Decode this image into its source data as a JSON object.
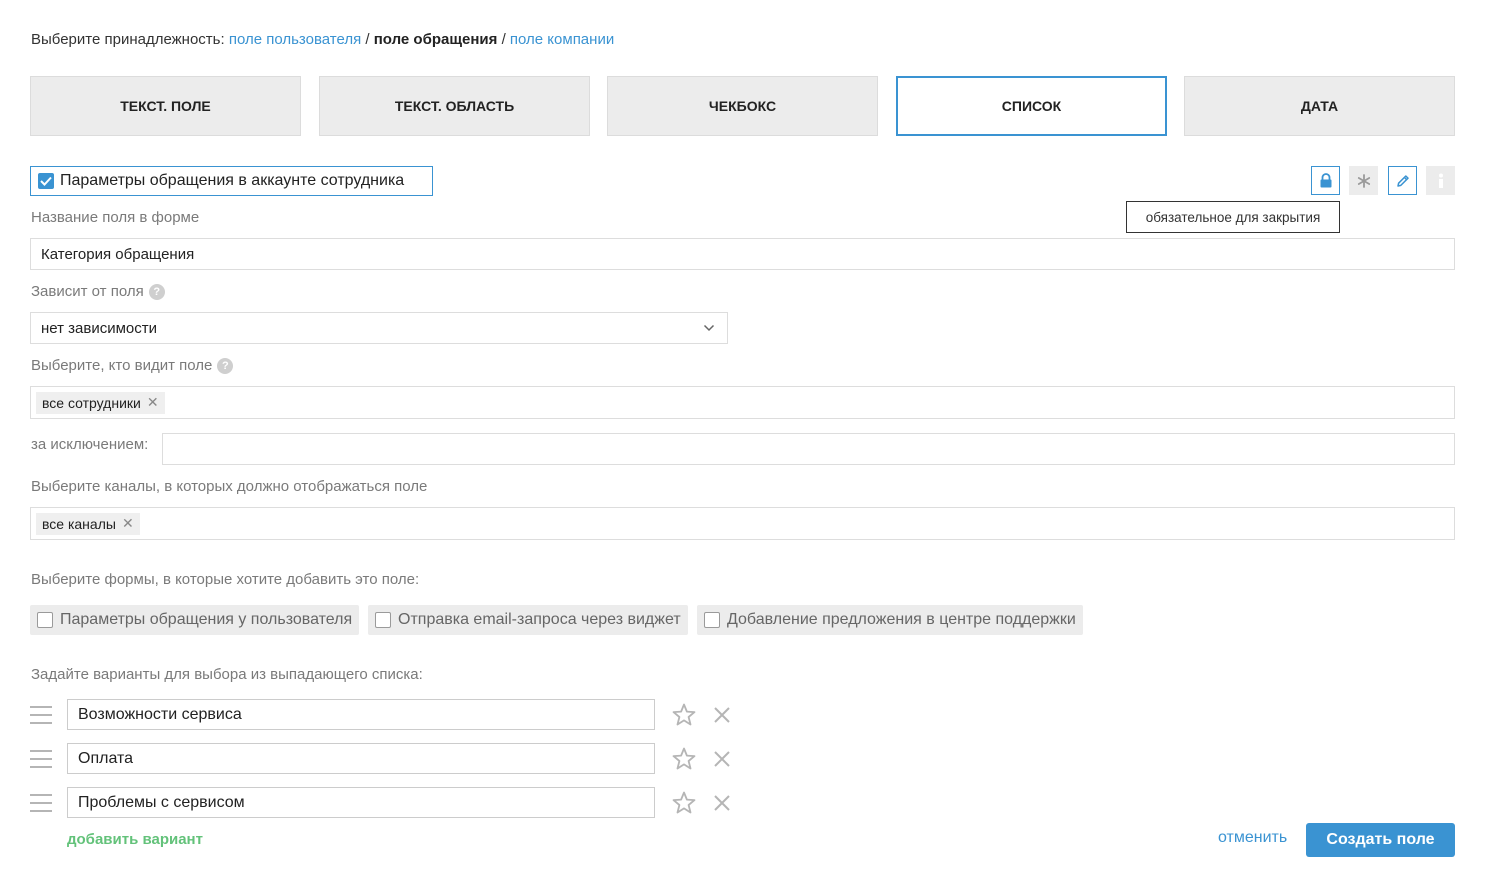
{
  "affiliation": {
    "prefix": "Выберите принадлежность:",
    "user_field": "поле пользователя",
    "separator1": "/",
    "request_field": "поле обращения",
    "separator2": "/",
    "company_field": "поле компании"
  },
  "tabs": [
    {
      "label": "ТЕКСТ. ПОЛЕ",
      "active": false
    },
    {
      "label": "ТЕКСТ. ОБЛАСТЬ",
      "active": false
    },
    {
      "label": "ЧЕКБОКС",
      "active": false
    },
    {
      "label": "СПИСОК",
      "active": true
    },
    {
      "label": "ДАТА",
      "active": false
    }
  ],
  "employee_params": {
    "label": "Параметры обращения в аккаунте сотрудника",
    "checked": true
  },
  "toolbar_icons": [
    "lock-icon",
    "asterisk-icon",
    "pencil-icon",
    "info-icon"
  ],
  "tooltip": "обязательное для закрытия",
  "field_name": {
    "label": "Название поля в форме",
    "value": "Категория обращения"
  },
  "depends_on": {
    "label": "Зависит от поля",
    "value": "нет зависимости"
  },
  "visibility": {
    "label": "Выберите, кто видит поле",
    "tags": [
      "все сотрудники"
    ]
  },
  "exceptions": {
    "label": "за исключением:",
    "value": ""
  },
  "channels": {
    "label": "Выберите каналы, в которых должно отображаться поле",
    "tags": [
      "все каналы"
    ]
  },
  "forms": {
    "label": "Выберите формы, в которые хотите добавить это поле:",
    "items": [
      {
        "label": "Параметры обращения у пользователя",
        "checked": false
      },
      {
        "label": "Отправка email-запроса через виджет",
        "checked": false
      },
      {
        "label": "Добавление предложения в центре поддержки",
        "checked": false
      }
    ]
  },
  "options": {
    "label": "Задайте варианты для выбора из выпадающего списка:",
    "items": [
      "Возможности сервиса",
      "Оплата",
      "Проблемы с сервисом"
    ]
  },
  "actions": {
    "add_option": "добавить вариант",
    "cancel": "отменить",
    "create": "Создать поле"
  },
  "colors": {
    "accent": "#3a93d2",
    "add_green": "#63c27a",
    "tab_bg": "#ececec"
  }
}
